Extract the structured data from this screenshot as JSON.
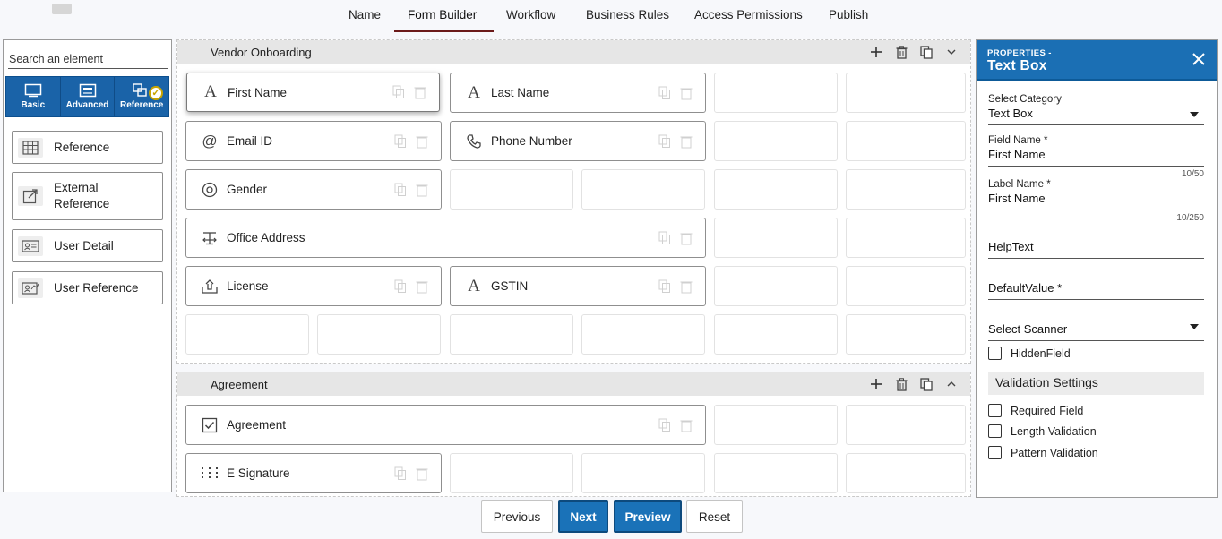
{
  "tabs": [
    "Name",
    "Form Builder",
    "Workflow",
    "Business Rules",
    "Access Permissions",
    "Publish"
  ],
  "active_tab": "Form Builder",
  "left_panel": {
    "search_placeholder": "Search an element",
    "categories": [
      {
        "label": "Basic",
        "icon": "monitor-icon"
      },
      {
        "label": "Advanced",
        "icon": "advanced-card-icon"
      },
      {
        "label": "Reference",
        "icon": "reference-icon"
      }
    ],
    "active_category": "Reference",
    "elements": [
      {
        "label": "Reference",
        "icon": "table-icon"
      },
      {
        "label": "External\nReference",
        "icon": "external-link-icon"
      },
      {
        "label": "User Detail",
        "icon": "id-card-icon"
      },
      {
        "label": "User Reference",
        "icon": "user-link-icon"
      }
    ]
  },
  "sections": [
    {
      "title": "Vendor Onboarding",
      "fields": [
        {
          "label": "First Name",
          "icon": "text-a-icon",
          "selected": true
        },
        {
          "label": "Last Name",
          "icon": "text-a-icon"
        },
        {
          "label": "Email ID",
          "icon": "at-icon"
        },
        {
          "label": "Phone Number",
          "icon": "phone-icon"
        },
        {
          "label": "Gender",
          "icon": "radio-icon"
        },
        {
          "label": "Office Address",
          "icon": "address-icon"
        },
        {
          "label": "License",
          "icon": "upload-icon"
        },
        {
          "label": "GSTIN",
          "icon": "text-a-icon"
        }
      ],
      "collapse_icon": "chevron-down-icon"
    },
    {
      "title": "Agreement",
      "fields": [
        {
          "label": "Agreement",
          "icon": "checkbox-icon"
        },
        {
          "label": "E Signature",
          "icon": "signature-icon"
        }
      ],
      "collapse_icon": "chevron-up-icon"
    }
  ],
  "properties": {
    "subtitle": "PROPERTIES -",
    "title": "Text Box",
    "select_category_label": "Select Category",
    "select_category_value": "Text Box",
    "field_name_label": "Field Name *",
    "field_name_value": "First Name",
    "field_name_counter": "10/50",
    "label_name_label": "Label Name *",
    "label_name_value": "First Name",
    "label_name_counter": "10/250",
    "helptext_placeholder": "HelpText",
    "default_value_placeholder": "DefaultValue *",
    "select_scanner_placeholder": "Select Scanner",
    "hidden_field_label": "HiddenField",
    "validation_heading": "Validation Settings",
    "validations": [
      "Required Field",
      "Length Validation",
      "Pattern Validation"
    ]
  },
  "footer": {
    "previous": "Previous",
    "next": "Next",
    "preview": "Preview",
    "reset": "Reset"
  },
  "colors": {
    "accent": "#1a72b8",
    "tab_underline": "#6b1a1a"
  }
}
